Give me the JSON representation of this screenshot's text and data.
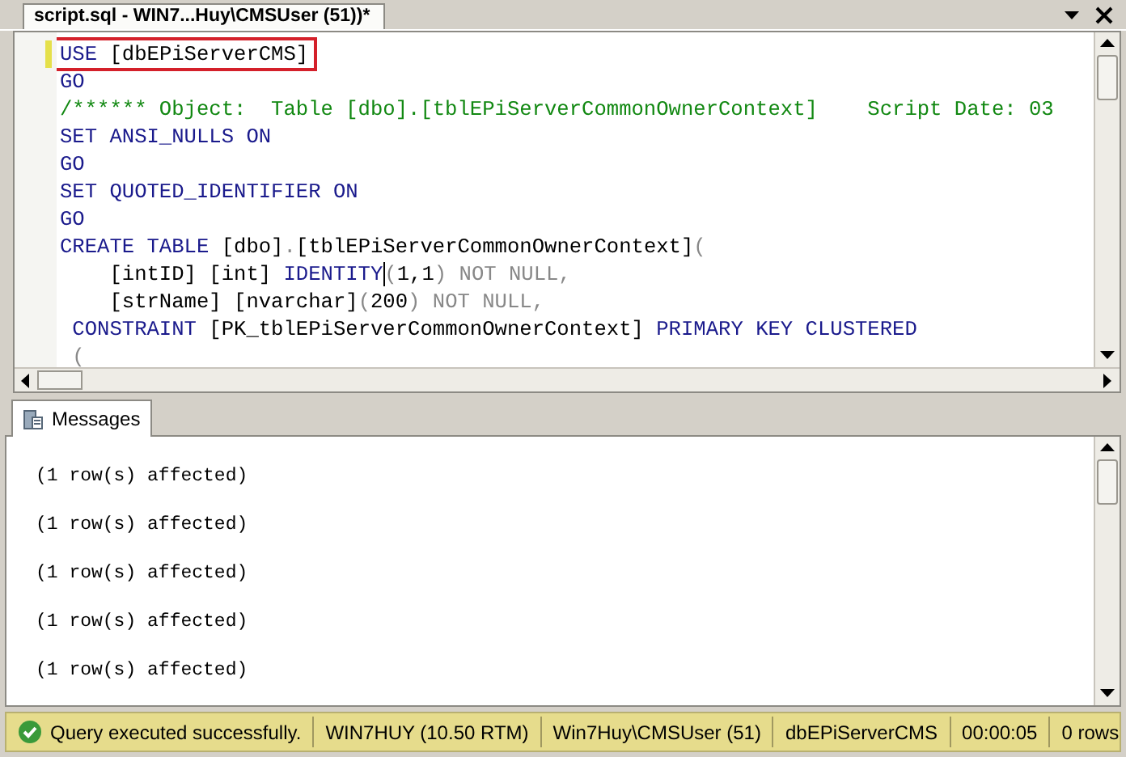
{
  "document_tab": {
    "title": "script.sql - WIN7...Huy\\CMSUser (51))*",
    "selected": true
  },
  "editor": {
    "lines": [
      {
        "highlighted": true,
        "changed": true,
        "tokens": [
          {
            "text": "USE",
            "kind": "keyword"
          },
          {
            "text": " [dbEPiServerCMS]",
            "kind": "plain"
          }
        ]
      },
      {
        "tokens": [
          {
            "text": "GO",
            "kind": "keyword"
          }
        ]
      },
      {
        "tokens": [
          {
            "text": "/****** Object:  Table [dbo].[tblEPiServerCommonOwnerContext]    Script Date: 03",
            "kind": "comment"
          }
        ]
      },
      {
        "tokens": [
          {
            "text": "SET ANSI_NULLS ON",
            "kind": "keyword"
          }
        ]
      },
      {
        "tokens": [
          {
            "text": "GO",
            "kind": "keyword"
          }
        ]
      },
      {
        "tokens": [
          {
            "text": "SET QUOTED_IDENTIFIER ON",
            "kind": "keyword"
          }
        ]
      },
      {
        "tokens": [
          {
            "text": "GO",
            "kind": "keyword"
          }
        ]
      },
      {
        "tokens": [
          {
            "text": "CREATE TABLE",
            "kind": "keyword"
          },
          {
            "text": " [dbo]",
            "kind": "plain"
          },
          {
            "text": ".",
            "kind": "operator"
          },
          {
            "text": "[tblEPiServerCommonOwnerContext]",
            "kind": "plain"
          },
          {
            "text": "(",
            "kind": "operator"
          }
        ]
      },
      {
        "tokens": [
          {
            "text": "    [intID] [int] ",
            "kind": "plain"
          },
          {
            "text": "IDENTITY",
            "kind": "keyword",
            "caret": true
          },
          {
            "text": "(",
            "kind": "operator"
          },
          {
            "text": "1,1",
            "kind": "plain"
          },
          {
            "text": ") NOT NULL,",
            "kind": "operator"
          }
        ]
      },
      {
        "tokens": [
          {
            "text": "    [strName] [nvarchar]",
            "kind": "plain"
          },
          {
            "text": "(",
            "kind": "operator"
          },
          {
            "text": "200",
            "kind": "plain"
          },
          {
            "text": ") NOT NULL,",
            "kind": "operator"
          }
        ]
      },
      {
        "tokens": [
          {
            "text": " CONSTRAINT",
            "kind": "keyword"
          },
          {
            "text": " [PK_tblEPiServerCommonOwnerContext]",
            "kind": "plain"
          },
          {
            "text": " PRIMARY KEY CLUSTERED",
            "kind": "keyword"
          }
        ]
      },
      {
        "tokens": [
          {
            "text": " (",
            "kind": "operator"
          }
        ]
      }
    ]
  },
  "results_tabs": [
    {
      "label": "Messages",
      "selected": true
    }
  ],
  "messages": [
    "(1 row(s) affected)",
    "(1 row(s) affected)",
    "(1 row(s) affected)",
    "(1 row(s) affected)",
    "(1 row(s) affected)"
  ],
  "status_bar": {
    "items": [
      {
        "text": "Query executed successfully.",
        "kind": "success"
      },
      {
        "text": "WIN7HUY (10.50 RTM)",
        "kind": "plain"
      },
      {
        "text": "Win7Huy\\CMSUser (51)",
        "kind": "plain"
      },
      {
        "text": "dbEPiServerCMS",
        "kind": "plain"
      },
      {
        "text": "00:00:05",
        "kind": "plain"
      },
      {
        "text": "0 rows",
        "kind": "plain"
      }
    ]
  }
}
